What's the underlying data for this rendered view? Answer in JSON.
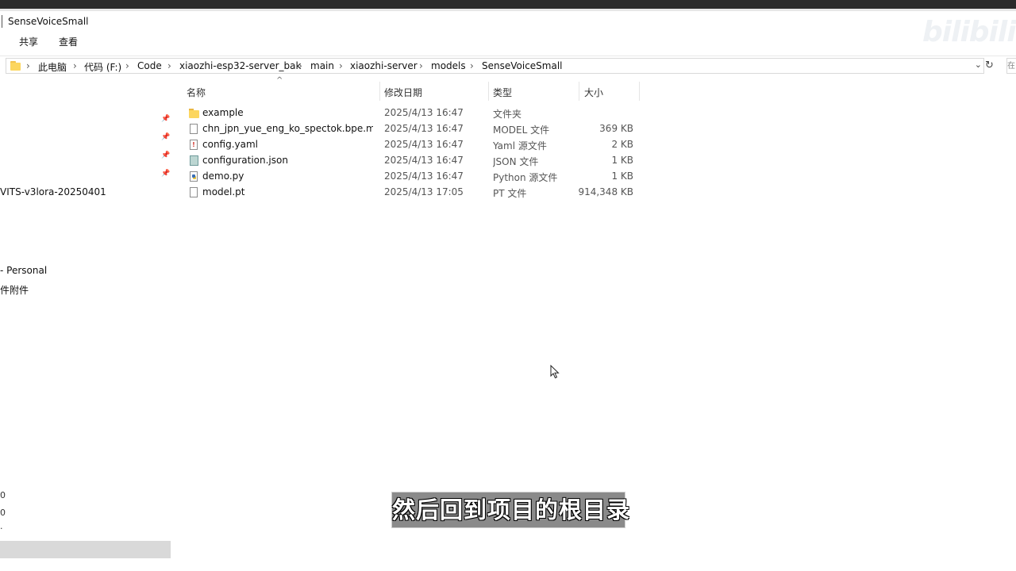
{
  "window": {
    "title": "SenseVoiceSmall",
    "watermark": "bilibili"
  },
  "ribbon": {
    "share": "共享",
    "view": "查看"
  },
  "address": {
    "crumbs": [
      "此电脑",
      "代码 (F:)",
      "Code",
      "xiaozhi-esp32-server_bak",
      "main",
      "xiaozhi-server",
      "models",
      "SenseVoiceSmall"
    ],
    "separator": "›",
    "dropdown_glyph": "⌄",
    "refresh_glyph": "↻",
    "right_glyph": "在"
  },
  "nav": {
    "items": [
      "VITS-v3lora-20250401",
      "- Personal",
      "件附件"
    ],
    "edge_chars": [
      "0",
      "0",
      "·"
    ],
    "pin_glyph": "📌"
  },
  "columns": {
    "name": "名称",
    "date": "修改日期",
    "type": "类型",
    "size": "大小",
    "sort_glyph": "^"
  },
  "files": [
    {
      "name": "example",
      "date": "2025/4/13 16:47",
      "type": "文件夹",
      "size": "",
      "icon": "folder-icon"
    },
    {
      "name": "chn_jpn_yue_eng_ko_spectok.bpe.mo...",
      "date": "2025/4/13 16:47",
      "type": "MODEL 文件",
      "size": "369 KB",
      "icon": "file-icon"
    },
    {
      "name": "config.yaml",
      "date": "2025/4/13 16:47",
      "type": "Yaml 源文件",
      "size": "2 KB",
      "icon": "yaml-file-icon"
    },
    {
      "name": "configuration.json",
      "date": "2025/4/13 16:47",
      "type": "JSON 文件",
      "size": "1 KB",
      "icon": "json-file-icon"
    },
    {
      "name": "demo.py",
      "date": "2025/4/13 16:47",
      "type": "Python 源文件",
      "size": "1 KB",
      "icon": "python-file-icon"
    },
    {
      "name": "model.pt",
      "date": "2025/4/13 17:05",
      "type": "PT 文件",
      "size": "914,348 KB",
      "icon": "file-icon"
    }
  ],
  "subtitle": "然后回到项目的根目录",
  "colors": {
    "folder": "#fcd65f",
    "selection": "#d9d9d9",
    "subtitle_bg": "#8a8a8a"
  }
}
